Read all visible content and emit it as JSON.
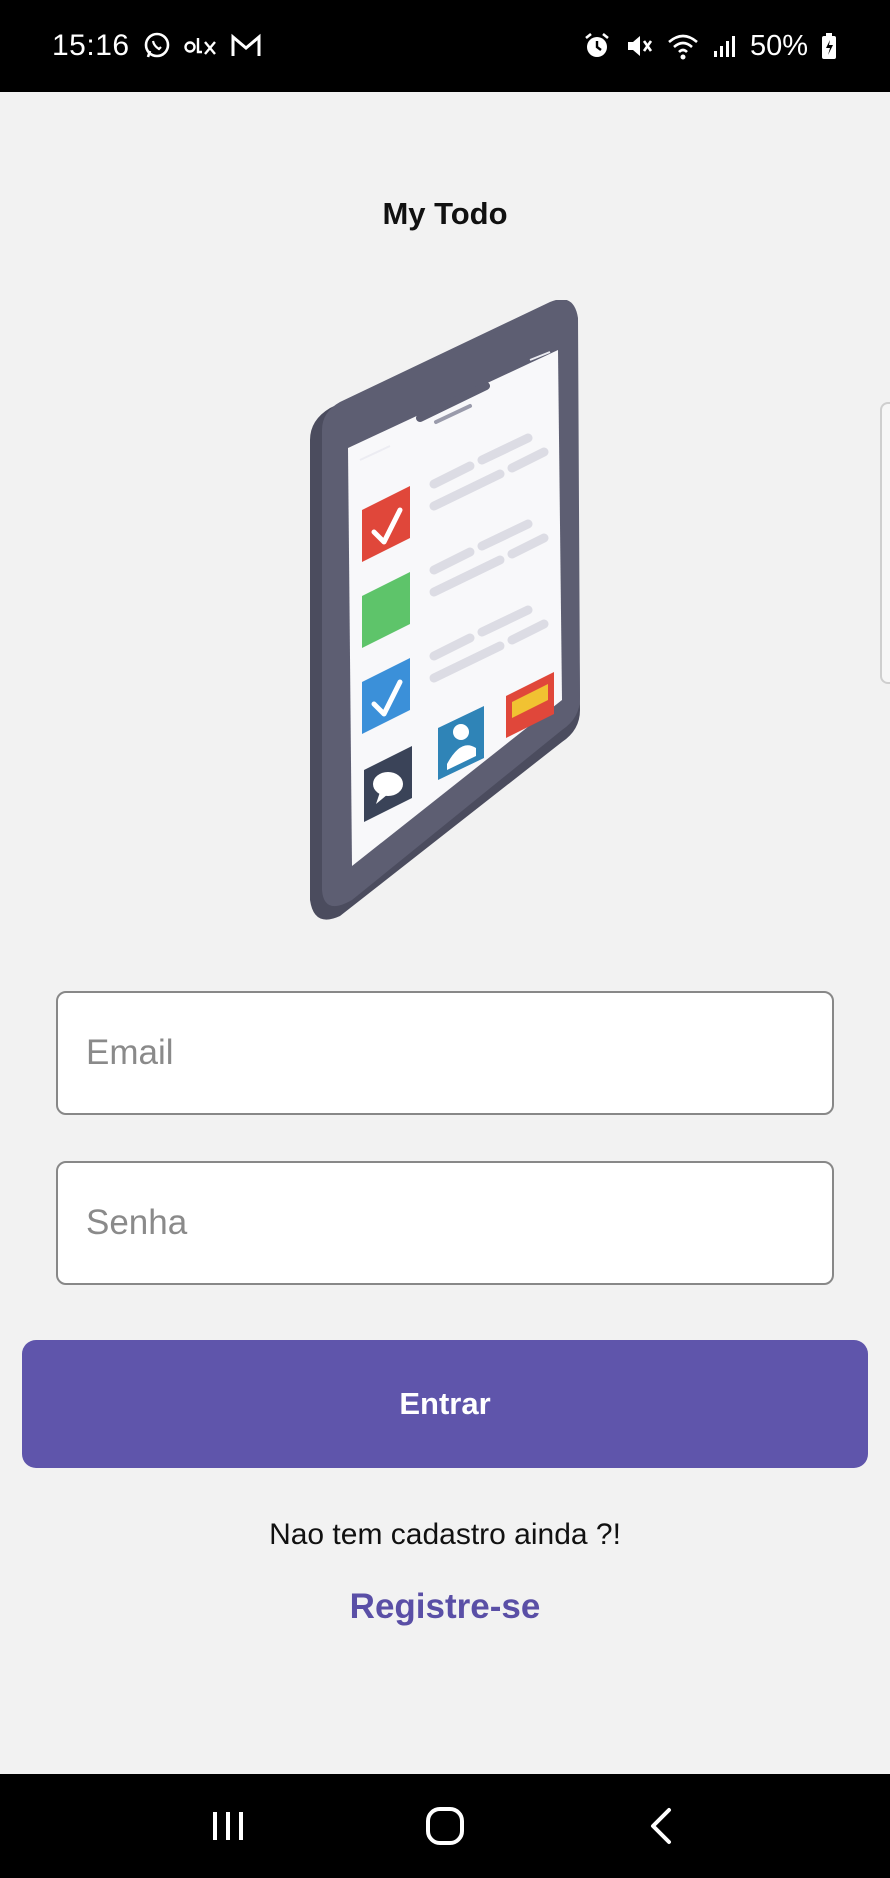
{
  "status_bar": {
    "time": "15:16",
    "left_icons": [
      "whatsapp-icon",
      "olx-icon",
      "gmail-icon"
    ],
    "right_icons": [
      "alarm-icon",
      "mute-icon",
      "wifi-icon",
      "signal-icon"
    ],
    "battery_text": "50%"
  },
  "app": {
    "title": "My Todo"
  },
  "form": {
    "email_placeholder": "Email",
    "email_value": "",
    "password_placeholder": "Senha",
    "password_value": "",
    "submit_label": "Entrar"
  },
  "register": {
    "prompt": "Nao tem cadastro ainda ?!",
    "link_label": "Registre-se"
  },
  "colors": {
    "primary": "#5f55ab",
    "link": "#5a4fa6",
    "background": "#f2f2f2"
  },
  "nav_bar": {
    "buttons": [
      "recent-apps-icon",
      "home-icon",
      "back-icon"
    ]
  }
}
